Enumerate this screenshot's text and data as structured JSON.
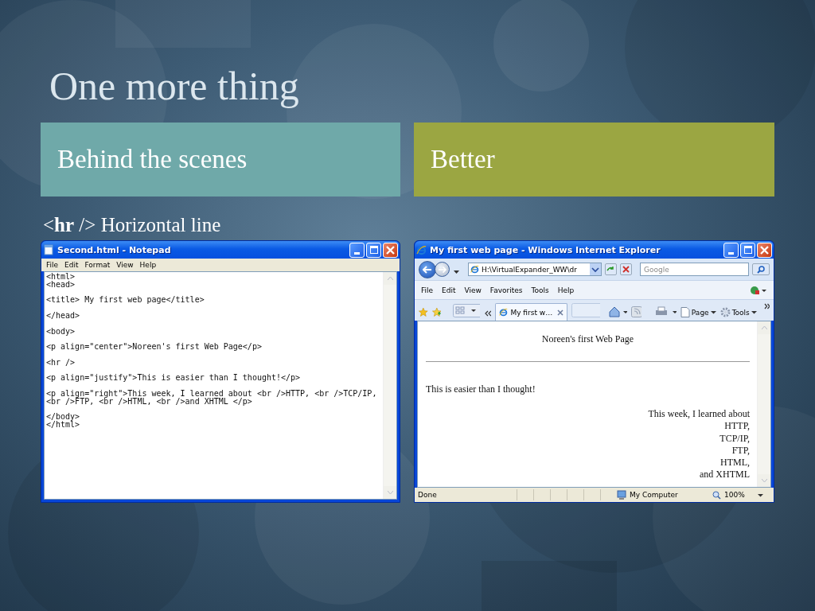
{
  "slide": {
    "title": "One more thing",
    "columns": [
      {
        "heading": "Behind the scenes",
        "color": "#6fa9a9"
      },
      {
        "heading": "Better",
        "color": "#9ba642"
      }
    ],
    "subtitle": "<**hr** /> Horizontal line"
  },
  "notepad": {
    "title": "Second.html - Notepad",
    "menu": [
      "File",
      "Edit",
      "Format",
      "View",
      "Help"
    ],
    "blocks": [
      [
        "<html>",
        "<head>"
      ],
      [
        "<title> My first web page</title>"
      ],
      [
        "</head>"
      ],
      [
        "<body>"
      ],
      [
        "<p align=\"center\">Noreen's first Web Page</p>"
      ],
      [
        "<hr />"
      ],
      [
        "<p align=\"justify\">This is easier than I thought!</p>"
      ],
      [
        "<p align=\"right\">This week, I learned about <br />HTTP, <br />TCP/IP,",
        "<br />FTP, <br />HTML, <br />and XHTML </p>"
      ],
      [
        "</body>",
        "</html>"
      ]
    ]
  },
  "browser": {
    "title": "My first web page - Windows Internet Explorer",
    "address": "H:\\VirtualExpander_WW\\dr",
    "search": {
      "placeholder": "Google"
    },
    "menu": [
      "File",
      "Edit",
      "View",
      "Favorites",
      "Tools",
      "Help"
    ],
    "tab": "My first w…",
    "toolbar": [
      "Page",
      "Tools"
    ],
    "content": {
      "heading": "Noreen's first Web Page",
      "paragraph": "This is easier than I thought!",
      "right_lines": [
        "This week, I learned about",
        "HTTP,",
        "TCP/IP,",
        "FTP,",
        "HTML,",
        "and XHTML"
      ]
    },
    "status": {
      "text": "Done",
      "zone": "My Computer",
      "zoom": "100%"
    }
  }
}
